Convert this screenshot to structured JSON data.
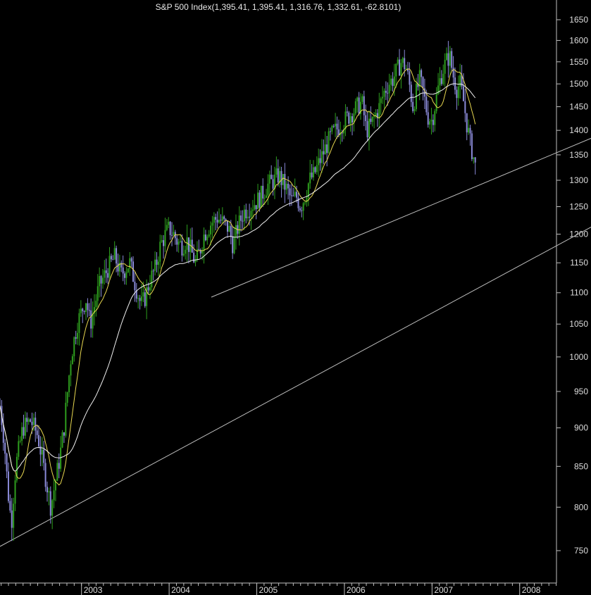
{
  "chart_data": {
    "type": "candlestick",
    "title": "S&P 500 Index",
    "ohlc_header": "(1,395.41, 1,395.41, 1,316.76, 1,332.61, -62.8101)",
    "y_axis": {
      "scale": "log",
      "ticks": [
        750,
        800,
        850,
        900,
        950,
        1000,
        1050,
        1100,
        1150,
        1200,
        1250,
        1300,
        1350,
        1400,
        1450,
        1500,
        1550,
        1600,
        1650
      ],
      "range": [
        720,
        1720
      ]
    },
    "x_axis": {
      "labels": [
        "2003",
        "2004",
        "2005",
        "2006",
        "2007",
        "2008"
      ],
      "range": [
        2002.07,
        2008.42
      ]
    },
    "colors": {
      "background": "#000000",
      "up_bar": "#2e9e1e",
      "down_bar": "#8a8ad8",
      "short_ma": "#e8d850",
      "long_ma": "#f0f0f0",
      "trendline": "#bdbdbd",
      "axis": "#c0c0c0"
    },
    "price_path": [
      [
        2002.07,
        930
      ],
      [
        2002.12,
        880
      ],
      [
        2002.16,
        820
      ],
      [
        2002.2,
        780
      ],
      [
        2002.25,
        850
      ],
      [
        2002.33,
        900
      ],
      [
        2002.42,
        910
      ],
      [
        2002.5,
        890
      ],
      [
        2002.55,
        860
      ],
      [
        2002.6,
        830
      ],
      [
        2002.65,
        800
      ],
      [
        2002.7,
        830
      ],
      [
        2002.75,
        860
      ],
      [
        2002.8,
        900
      ],
      [
        2002.88,
        1000
      ],
      [
        2002.95,
        1050
      ],
      [
        2003.05,
        1090
      ],
      [
        2003.1,
        1050
      ],
      [
        2003.2,
        1110
      ],
      [
        2003.3,
        1140
      ],
      [
        2003.38,
        1160
      ],
      [
        2003.45,
        1130
      ],
      [
        2003.55,
        1150
      ],
      [
        2003.62,
        1110
      ],
      [
        2003.68,
        1080
      ],
      [
        2003.72,
        1090
      ],
      [
        2003.78,
        1120
      ],
      [
        2003.84,
        1140
      ],
      [
        2003.9,
        1180
      ],
      [
        2003.96,
        1200
      ],
      [
        2004.0,
        1210
      ],
      [
        2004.05,
        1200
      ],
      [
        2004.1,
        1185
      ],
      [
        2004.15,
        1180
      ],
      [
        2004.2,
        1190
      ],
      [
        2004.25,
        1170
      ],
      [
        2004.3,
        1150
      ],
      [
        2004.35,
        1170
      ],
      [
        2004.4,
        1200
      ],
      [
        2004.48,
        1220
      ],
      [
        2004.55,
        1230
      ],
      [
        2004.62,
        1220
      ],
      [
        2004.68,
        1210
      ],
      [
        2004.73,
        1180
      ],
      [
        2004.78,
        1210
      ],
      [
        2004.85,
        1240
      ],
      [
        2004.92,
        1250
      ],
      [
        2005.0,
        1260
      ],
      [
        2005.05,
        1270
      ],
      [
        2005.12,
        1290
      ],
      [
        2005.2,
        1300
      ],
      [
        2005.25,
        1310
      ],
      [
        2005.3,
        1295
      ],
      [
        2005.35,
        1280
      ],
      [
        2005.4,
        1260
      ],
      [
        2005.45,
        1270
      ],
      [
        2005.5,
        1250
      ],
      [
        2005.55,
        1270
      ],
      [
        2005.6,
        1300
      ],
      [
        2005.65,
        1310
      ],
      [
        2005.7,
        1330
      ],
      [
        2005.75,
        1350
      ],
      [
        2005.8,
        1370
      ],
      [
        2005.85,
        1390
      ],
      [
        2005.9,
        1400
      ],
      [
        2005.95,
        1410
      ],
      [
        2006.0,
        1420
      ],
      [
        2006.05,
        1430
      ],
      [
        2006.1,
        1440
      ],
      [
        2006.15,
        1450
      ],
      [
        2006.2,
        1460
      ],
      [
        2006.25,
        1400
      ],
      [
        2006.3,
        1410
      ],
      [
        2006.35,
        1430
      ],
      [
        2006.4,
        1450
      ],
      [
        2006.45,
        1480
      ],
      [
        2006.5,
        1500
      ],
      [
        2006.55,
        1510
      ],
      [
        2006.6,
        1530
      ],
      [
        2006.65,
        1550
      ],
      [
        2006.7,
        1540
      ],
      [
        2006.74,
        1500
      ],
      [
        2006.78,
        1450
      ],
      [
        2006.82,
        1480
      ],
      [
        2006.86,
        1510
      ],
      [
        2006.9,
        1480
      ],
      [
        2006.95,
        1430
      ],
      [
        2007.0,
        1420
      ],
      [
        2007.04,
        1460
      ],
      [
        2007.08,
        1500
      ],
      [
        2007.12,
        1530
      ],
      [
        2007.16,
        1550
      ],
      [
        2007.2,
        1565
      ],
      [
        2007.24,
        1520
      ],
      [
        2007.28,
        1490
      ],
      [
        2007.32,
        1500
      ],
      [
        2007.36,
        1460
      ],
      [
        2007.4,
        1410
      ],
      [
        2007.44,
        1370
      ],
      [
        2007.48,
        1340
      ],
      [
        2007.5,
        1320
      ]
    ]
  }
}
